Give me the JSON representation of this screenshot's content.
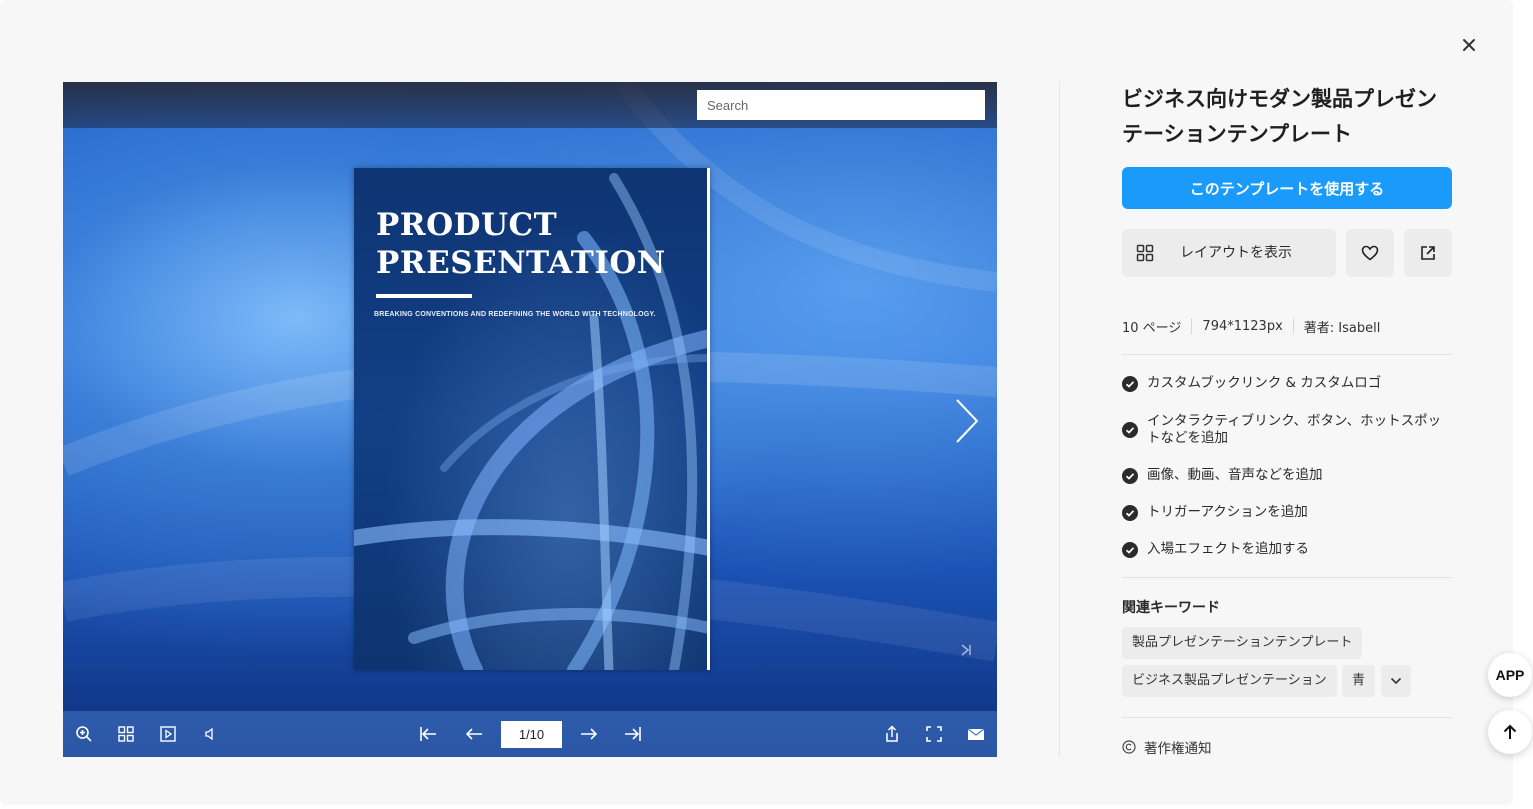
{
  "viewer": {
    "search_placeholder": "Search",
    "page_indicator": "1/10",
    "book_page": {
      "title": "PRODUCT\nPRESENTATION",
      "subtitle": "BREAKING CONVENTIONS AND REDEFINING THE WORLD WITH TECHNOLOGY."
    },
    "toolbar_left_icons": [
      "zoom-in-icon",
      "thumbnails-icon",
      "autoplay-icon",
      "sound-icon"
    ],
    "toolbar_center_icons": [
      "first-page-icon",
      "prev-page-icon",
      "next-page-icon",
      "last-page-icon"
    ],
    "toolbar_right_icons": [
      "share-icon",
      "fullscreen-icon",
      "email-icon"
    ]
  },
  "panel": {
    "title": "ビジネス向けモダン製品プレゼンテーションテンプレート",
    "use_button": "このテンプレートを使用する",
    "layout_button": "レイアウトを表示",
    "meta": {
      "pages": "10 ページ",
      "size": "794*1123px",
      "author": "著者: Isabell"
    },
    "features": [
      "カスタムブックリンク & カスタムロゴ",
      "インタラクティブリンク、ボタン、ホットスポットなどを追加",
      "画像、動画、音声などを追加",
      "トリガーアクションを追加",
      "入場エフェクトを追加する"
    ],
    "keywords_title": "関連キーワード",
    "keywords": [
      "製品プレゼンテーションテンプレート",
      "ビジネス製品プレゼンテーション",
      "青"
    ],
    "copyright": "著作権通知"
  },
  "floating": {
    "app_label": "APP"
  },
  "colors": {
    "primary": "#1a9bfc",
    "secondary_bg": "#ececec",
    "modal_bg": "#f7f7f7"
  }
}
